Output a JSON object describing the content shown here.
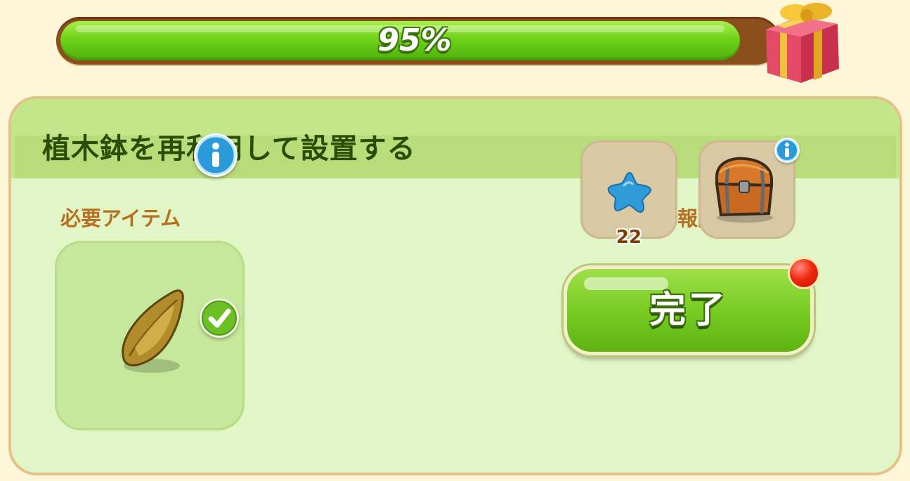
{
  "progress": {
    "percent_label": "95%",
    "value": 0.95,
    "fill_color": "#6fd21a",
    "track_color": "#8a4f1c"
  },
  "gift": {
    "icon": "gift-box-icon"
  },
  "task": {
    "title": "植木鉢を再利用して設置する",
    "required_label": "必要アイテム",
    "required_item": {
      "icon": "golden-seed-icon",
      "info_icon": "info-icon",
      "status_icon": "checkmark-icon"
    },
    "reward_label": "報酬",
    "rewards": [
      {
        "icon": "blue-star-icon",
        "count": "22"
      },
      {
        "icon": "treasure-chest-icon",
        "info_icon": "info-icon"
      }
    ],
    "complete_button": {
      "label": "完了",
      "notification_icon": "red-notification-dot"
    }
  },
  "colors": {
    "background": "#fdf7d8",
    "panel": "#e2f5c6",
    "panel_header": "#c3e68a",
    "title_text": "#2a4d06",
    "section_label": "#b86f22",
    "button_green": "#78cc22"
  }
}
